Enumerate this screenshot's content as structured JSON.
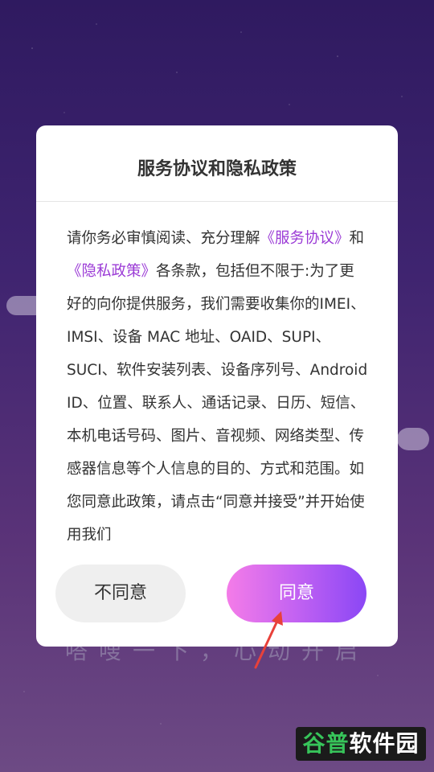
{
  "dialog": {
    "title": "服务协议和隐私政策",
    "body": {
      "intro": "请你务必审慎阅读、充分理解",
      "link_service": "《服务协议》",
      "conj": "和",
      "link_privacy": "《隐私政策》",
      "rest": "各条款，包括但不限于:为了更好的向你提供服务，我们需要收集你的IMEI、IMSI、设备 MAC 地址、OAID、SUPI、SUCI、软件安装列表、设备序列号、Android ID、位置、联系人、通话记录、日历、短信、本机电话号码、图片、音视频、网络类型、传感器信息等个人信息的目的、方式和范围。如您同意此政策，请点击“同意并接受”并开始使用我们"
    },
    "disagree_label": "不同意",
    "agree_label": "同意"
  },
  "background": {
    "slogan": "嗒嗖一下，心动开启"
  },
  "watermark": {
    "part1": "谷普",
    "part2": "软件园"
  },
  "colors": {
    "link": "#9b3bd6",
    "agree_gradient_start": "#f47ce8",
    "agree_gradient_end": "#8a47f5",
    "arrow": "#e8413a"
  }
}
